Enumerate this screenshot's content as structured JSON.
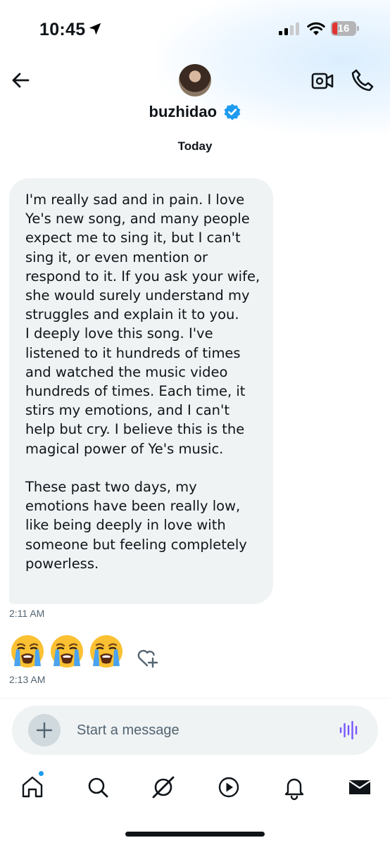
{
  "status_bar": {
    "time": "10:45",
    "battery_percent": "16"
  },
  "header": {
    "username": "buzhidao",
    "verified": true,
    "date_separator": "Today"
  },
  "messages": [
    {
      "type": "text",
      "text": "I'm really sad and in pain. I love Ye's new song, and many people expect me to sing it, but I can't sing it, or even mention or respond to it. If you ask your wife, she would surely understand my struggles and explain it to you.\nI deeply love this song. I've listened to it hundreds of times and watched the music video hundreds of times. Each time, it stirs my emotions, and I can't help but cry. I believe this is the magical power of Ye's music.\n\nThese past two days, my emotions have been really low, like being deeply in love with someone but feeling completely powerless.",
      "timestamp": "2:11 AM"
    },
    {
      "type": "emoji",
      "emojis": [
        "loudly-crying-face",
        "loudly-crying-face",
        "loudly-crying-face"
      ],
      "timestamp": "2:13 AM"
    }
  ],
  "composer": {
    "placeholder": "Start a message"
  },
  "tabs": [
    {
      "name": "home",
      "icon": "home-icon",
      "has_notification_dot": true
    },
    {
      "name": "search",
      "icon": "search-icon"
    },
    {
      "name": "grok",
      "icon": "grok-icon"
    },
    {
      "name": "video",
      "icon": "play-icon"
    },
    {
      "name": "notifications",
      "icon": "bell-icon"
    },
    {
      "name": "messages",
      "icon": "mail-icon",
      "active": true
    }
  ],
  "colors": {
    "accent": "#1d9bf0",
    "bubble": "#eff3f4",
    "secondary_text": "#536471",
    "voice_icon": "#7856ff"
  }
}
